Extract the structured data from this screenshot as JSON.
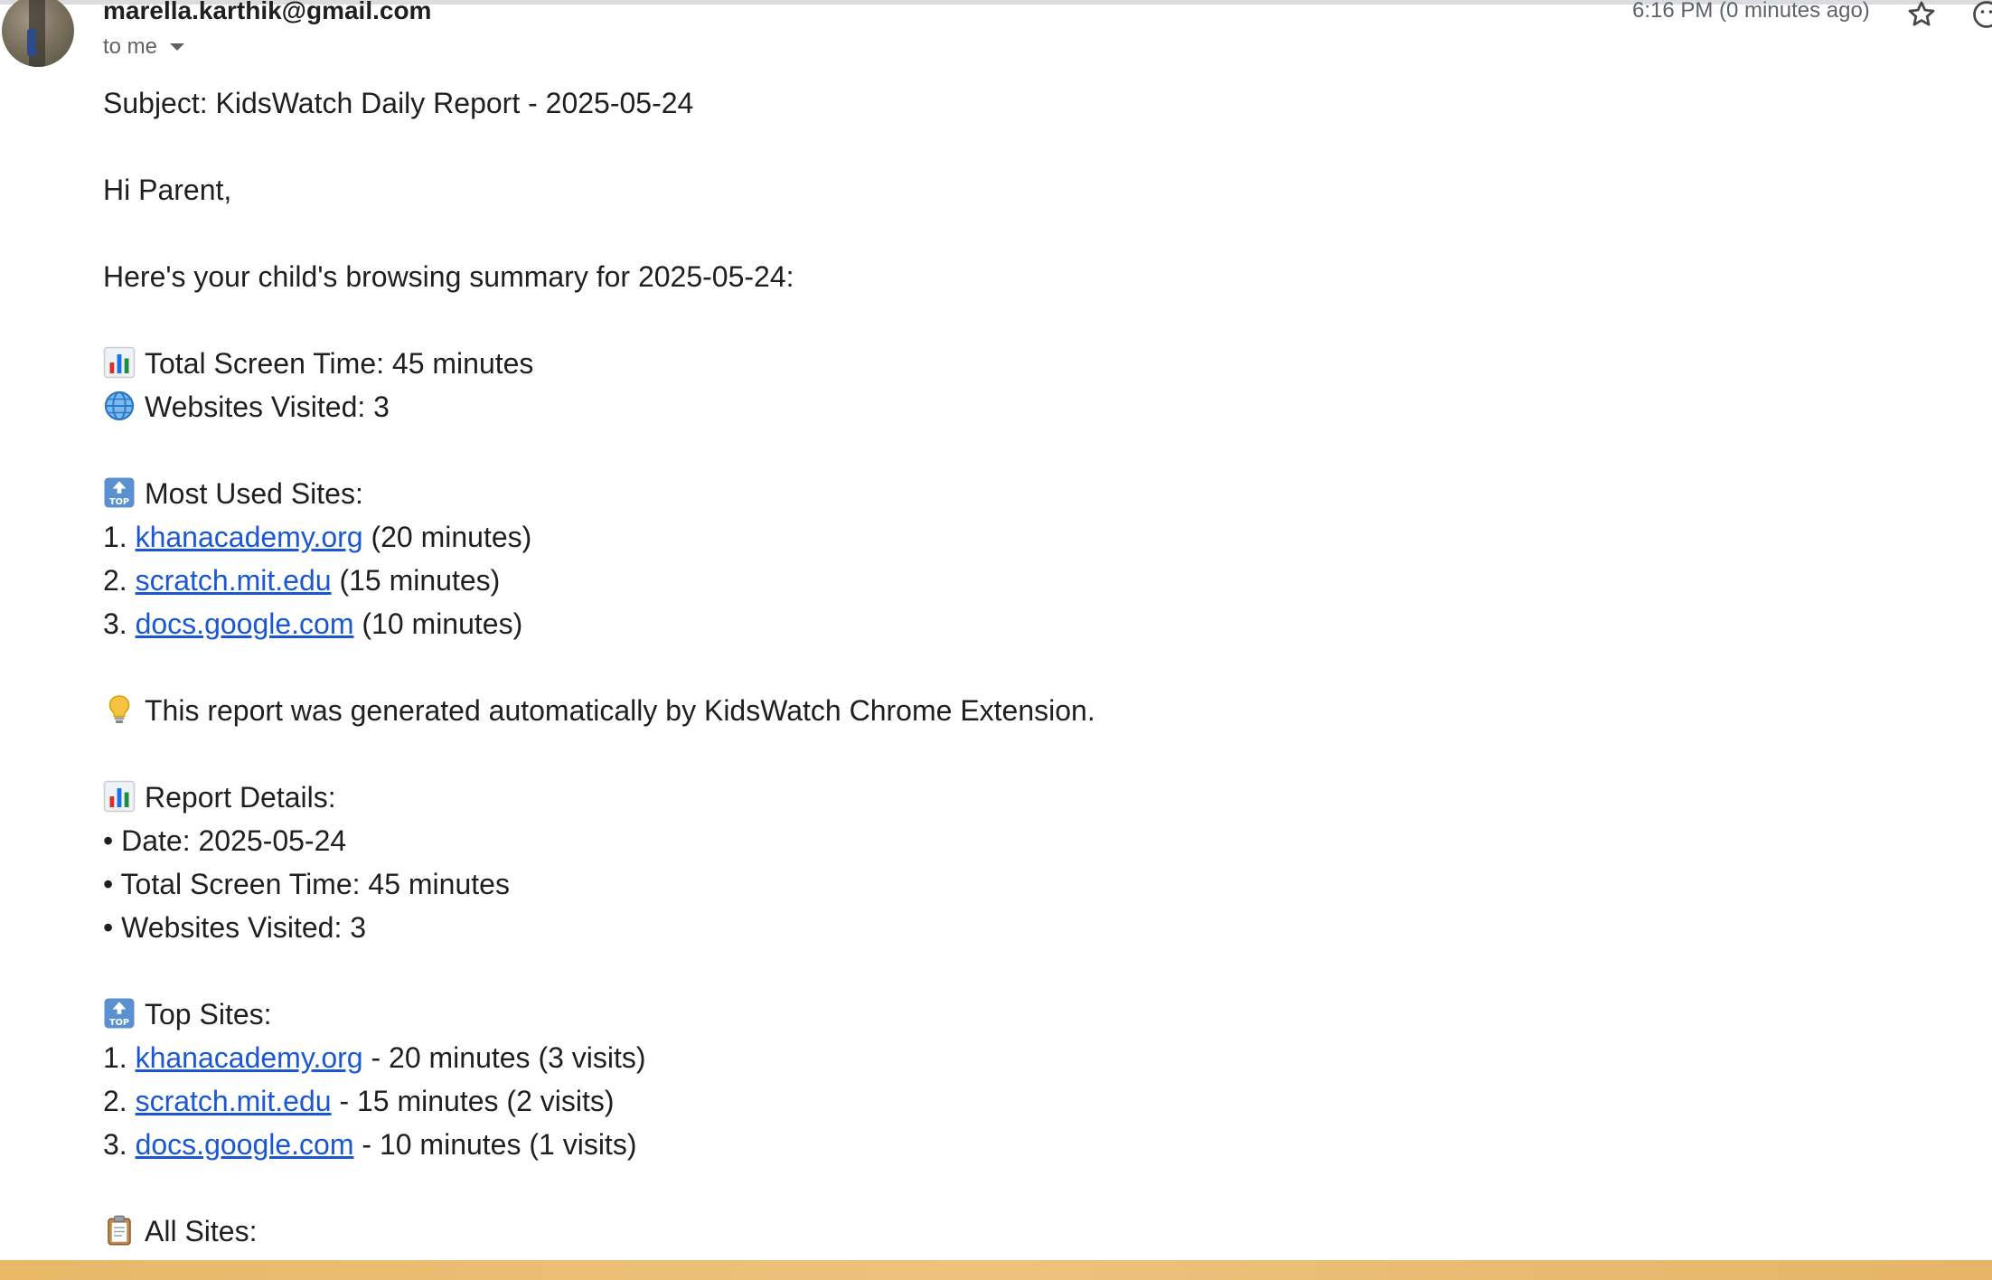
{
  "header": {
    "sender": "marella.karthik@gmail.com",
    "recipient": "to me",
    "timestamp": "6:16 PM (0 minutes ago)",
    "star_icon": "star-outline-icon",
    "emoji_icon": "emoji-react-icon"
  },
  "email": {
    "subject_line": "Subject: KidsWatch Daily Report - 2025-05-24",
    "greeting": "Hi Parent,",
    "intro": "Here's your child's browsing summary for 2025-05-24:",
    "summary": {
      "screen_time": "Total Screen Time: 45 minutes",
      "websites_visited": "Websites Visited: 3"
    },
    "most_used": {
      "heading": "Most Used Sites:",
      "items": [
        {
          "num": "1.",
          "site": "khanacademy.org",
          "detail": "(20 minutes)"
        },
        {
          "num": "2.",
          "site": "scratch.mit.edu",
          "detail": "(15 minutes)"
        },
        {
          "num": "3.",
          "site": "docs.google.com",
          "detail": "(10 minutes)"
        }
      ]
    },
    "footer_note": "This report was generated automatically by KidsWatch Chrome Extension.",
    "details": {
      "heading": "Report Details:",
      "items": [
        "• Date: 2025-05-24",
        "• Total Screen Time: 45 minutes",
        "• Websites Visited: 3"
      ]
    },
    "top_sites": {
      "heading": "Top Sites:",
      "items": [
        {
          "num": "1.",
          "site": "khanacademy.org",
          "detail": "- 20 minutes (3 visits)"
        },
        {
          "num": "2.",
          "site": "scratch.mit.edu",
          "detail": "- 15 minutes (2 visits)"
        },
        {
          "num": "3.",
          "site": "docs.google.com",
          "detail": "- 10 minutes (1 visits)"
        }
      ]
    },
    "all_sites": {
      "heading": "All Sites:"
    }
  },
  "colors": {
    "link": "#1a57d4",
    "text": "#1f1f1f",
    "meta": "#5f6368",
    "bottom_bar": "#edc27c"
  }
}
